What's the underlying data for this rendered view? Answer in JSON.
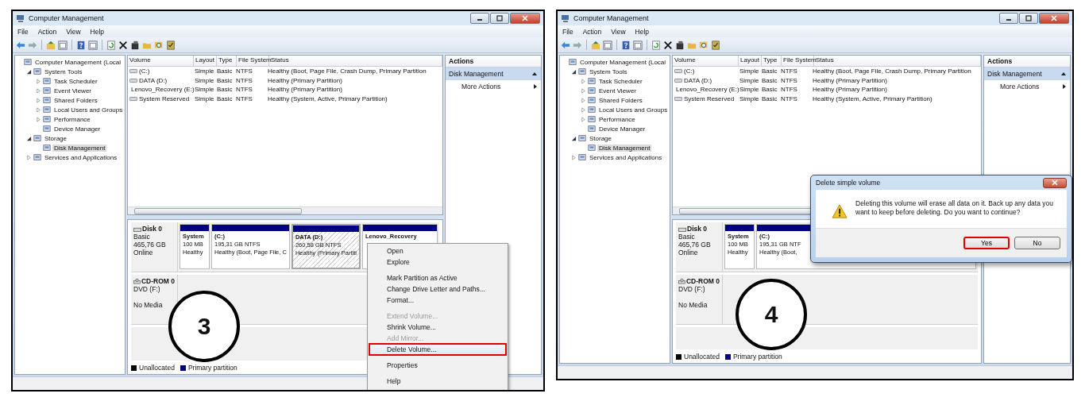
{
  "panels": [
    {
      "step": "3",
      "window": {
        "title": "Computer Management",
        "menu": [
          "File",
          "Action",
          "View",
          "Help"
        ],
        "tree": [
          {
            "label": "Computer Management (Local",
            "selected": false,
            "children": [
              {
                "label": "System Tools",
                "expanded": true,
                "selected": false,
                "children": [
                  {
                    "label": "Task Scheduler",
                    "expanded": false,
                    "selected": false
                  },
                  {
                    "label": "Event Viewer",
                    "expanded": false,
                    "selected": false
                  },
                  {
                    "label": "Shared Folders",
                    "expanded": false,
                    "selected": false
                  },
                  {
                    "label": "Local Users and Groups",
                    "expanded": false,
                    "selected": false
                  },
                  {
                    "label": "Performance",
                    "expanded": false,
                    "selected": false
                  },
                  {
                    "label": "Device Manager",
                    "selected": false
                  }
                ]
              },
              {
                "label": "Storage",
                "expanded": true,
                "selected": false,
                "children": [
                  {
                    "label": "Disk Management",
                    "selected": true
                  }
                ]
              },
              {
                "label": "Services and Applications",
                "expanded": false,
                "selected": false
              }
            ]
          }
        ],
        "volumes": {
          "columns": [
            "Volume",
            "Layout",
            "Type",
            "File System",
            "Status"
          ],
          "rows": [
            [
              "(C:)",
              "Simple",
              "Basic",
              "NTFS",
              "Healthy (Boot, Page File, Crash Dump, Primary Partition"
            ],
            [
              "DATA (D:)",
              "Simple",
              "Basic",
              "NTFS",
              "Healthy (Primary Partition)"
            ],
            [
              "Lenovo_Recovery (E:)",
              "Simple",
              "Basic",
              "NTFS",
              "Healthy (Primary Partition)"
            ],
            [
              "System Reserved",
              "Simple",
              "Basic",
              "NTFS",
              "Healthy (System, Active, Primary Partition)"
            ]
          ]
        },
        "actions": {
          "title": "Actions",
          "section": "Disk Management",
          "items": [
            "More Actions"
          ]
        },
        "disks": [
          {
            "name": "Disk 0",
            "kind": "disk",
            "info": [
              "Basic",
              "465,76 GB",
              "Online"
            ],
            "partitions": [
              {
                "name": "System",
                "lines": [
                  "100 MB",
                  "Healthy"
                ],
                "selected": false
              },
              {
                "name": "(C:)",
                "lines": [
                  "195,31 GB NTFS",
                  "Healthy (Boot, Page File, C"
                ],
                "selected": false
              },
              {
                "name": "DATA  (D:)",
                "lines": [
                  "260,58 GB NTFS",
                  "Healthy (Primary Partiti"
                ],
                "selected": true
              },
              {
                "name": "Lenovo_Recovery",
                "selected": false
              }
            ]
          },
          {
            "name": "CD-ROM 0",
            "kind": "cdrom",
            "info": [
              "DVD (F:)",
              "No Media"
            ]
          }
        ],
        "legend": [
          {
            "label": "Unallocated",
            "color": "#000000"
          },
          {
            "label": "Primary partition",
            "color": "#000080"
          }
        ]
      },
      "context_menu": {
        "groups": [
          [
            {
              "label": "Open",
              "disabled": false,
              "highlighted": false
            },
            {
              "label": "Explore",
              "disabled": false,
              "highlighted": false
            }
          ],
          [
            {
              "label": "Mark Partition as Active",
              "disabled": false,
              "highlighted": false
            },
            {
              "label": "Change Drive Letter and Paths...",
              "disabled": false,
              "highlighted": false
            },
            {
              "label": "Format...",
              "disabled": false,
              "highlighted": false
            }
          ],
          [
            {
              "label": "Extend Volume...",
              "disabled": true,
              "highlighted": false
            },
            {
              "label": "Shrink Volume...",
              "disabled": false,
              "highlighted": false
            },
            {
              "label": "Add Mirror...",
              "disabled": true,
              "highlighted": false
            },
            {
              "label": "Delete Volume...",
              "disabled": false,
              "highlighted": true
            }
          ],
          [
            {
              "label": "Properties",
              "disabled": false,
              "highlighted": false
            }
          ],
          [
            {
              "label": "Help",
              "disabled": false,
              "highlighted": false
            }
          ]
        ]
      }
    },
    {
      "step": "4",
      "window": {
        "title": "Computer Management",
        "menu": [
          "File",
          "Action",
          "View",
          "Help"
        ],
        "tree": [
          {
            "label": "Computer Management (Local",
            "selected": false,
            "children": [
              {
                "label": "System Tools",
                "expanded": true,
                "selected": false,
                "children": [
                  {
                    "label": "Task Scheduler",
                    "expanded": false,
                    "selected": false
                  },
                  {
                    "label": "Event Viewer",
                    "expanded": false,
                    "selected": false
                  },
                  {
                    "label": "Shared Folders",
                    "expanded": false,
                    "selected": false
                  },
                  {
                    "label": "Local Users and Groups",
                    "expanded": false,
                    "selected": false
                  },
                  {
                    "label": "Performance",
                    "expanded": false,
                    "selected": false
                  },
                  {
                    "label": "Device Manager",
                    "selected": false
                  }
                ]
              },
              {
                "label": "Storage",
                "expanded": true,
                "selected": false,
                "children": [
                  {
                    "label": "Disk Management",
                    "selected": true
                  }
                ]
              },
              {
                "label": "Services and Applications",
                "expanded": false,
                "selected": false
              }
            ]
          }
        ],
        "volumes": {
          "columns": [
            "Volume",
            "Layout",
            "Type",
            "File System",
            "Status"
          ],
          "rows": [
            [
              "(C:)",
              "Simple",
              "Basic",
              "NTFS",
              "Healthy (Boot, Page File, Crash Dump, Primary Partition"
            ],
            [
              "DATA (D:)",
              "Simple",
              "Basic",
              "NTFS",
              "Healthy (Primary Partition)"
            ],
            [
              "Lenovo_Recovery (E:)",
              "Simple",
              "Basic",
              "NTFS",
              "Healthy (Primary Partition)"
            ],
            [
              "System Reserved",
              "Simple",
              "Basic",
              "NTFS",
              "Healthy (System, Active, Primary Partition)"
            ]
          ]
        },
        "actions": {
          "title": "Actions",
          "section": "Disk Management",
          "items": [
            "More Actions"
          ]
        },
        "disks": [
          {
            "name": "Disk 0",
            "kind": "disk",
            "info": [
              "Basic",
              "465,76 GB",
              "Online"
            ],
            "partitions": [
              {
                "name": "System",
                "lines": [
                  "100 MB",
                  "Healthy"
                ],
                "selected": false
              },
              {
                "name": "(C:)",
                "lines": [
                  "195,31 GB NTF",
                  "Healthy (Boot,"
                ],
                "selected": false
              }
            ]
          },
          {
            "name": "CD-ROM 0",
            "kind": "cdrom",
            "info": [
              "DVD (F:)",
              "No Media"
            ]
          }
        ],
        "legend": [
          {
            "label": "Unallocated",
            "color": "#000000"
          },
          {
            "label": "Primary partition",
            "color": "#000080"
          }
        ]
      },
      "dialog": {
        "title": "Delete simple volume",
        "message": "Deleting this volume will erase all data on it. Back up any data you want to keep before deleting. Do you want to continue?",
        "buttons": [
          {
            "label": "Yes",
            "highlighted": true
          },
          {
            "label": "No",
            "highlighted": false
          }
        ]
      }
    }
  ]
}
